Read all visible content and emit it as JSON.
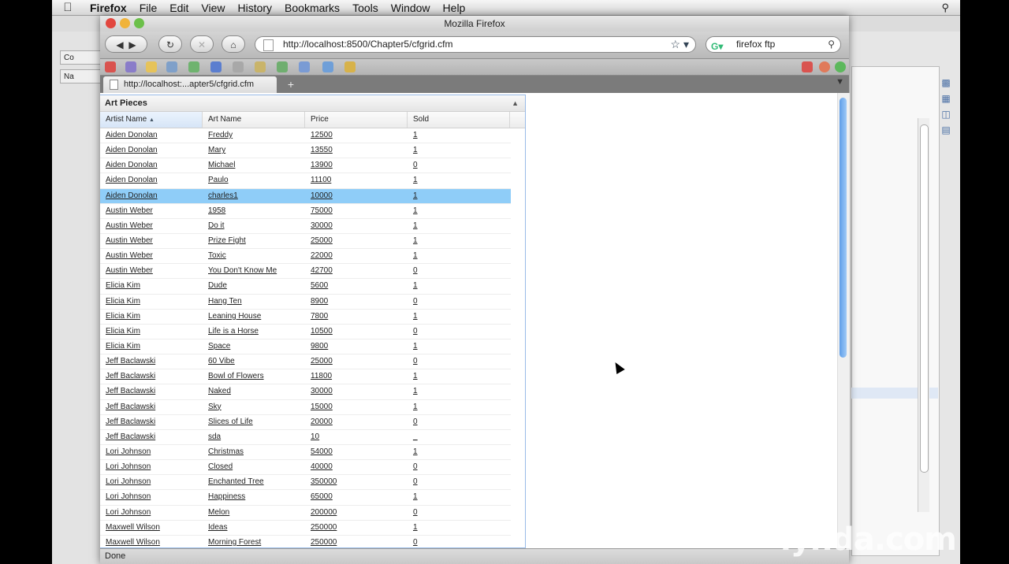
{
  "menubar": {
    "app": "Firefox",
    "items": [
      "File",
      "Edit",
      "View",
      "History",
      "Bookmarks",
      "Tools",
      "Window",
      "Help"
    ]
  },
  "window": {
    "title": "Mozilla Firefox"
  },
  "navbar": {
    "url": "http://localhost:8500/Chapter5/cfgrid.cfm",
    "search": "firefox ftp"
  },
  "tab": {
    "label": "http://localhost:...apter5/cfgrid.cfm",
    "new_tab": "+"
  },
  "background": {
    "tab1": "Co",
    "tab2": "Na"
  },
  "grid": {
    "title": "Art Pieces",
    "columns": [
      "Artist Name",
      "Art Name",
      "Price",
      "Sold"
    ],
    "selected_index": 4,
    "rows": [
      [
        "Aiden Donolan",
        "Freddy",
        "12500",
        "1"
      ],
      [
        "Aiden Donolan",
        "Mary",
        "13550",
        "1"
      ],
      [
        "Aiden Donolan",
        "Michael",
        "13900",
        "0"
      ],
      [
        "Aiden Donolan",
        "Paulo",
        "11100",
        "1"
      ],
      [
        "Aiden Donolan",
        "charles1",
        "10000",
        "1"
      ],
      [
        "Austin Weber",
        "1958",
        "75000",
        "1"
      ],
      [
        "Austin Weber",
        "Do it",
        "30000",
        "1"
      ],
      [
        "Austin Weber",
        "Prize Fight",
        "25000",
        "1"
      ],
      [
        "Austin Weber",
        "Toxic",
        "22000",
        "1"
      ],
      [
        "Austin Weber",
        "You Don't Know Me",
        "42700",
        "0"
      ],
      [
        "Elicia Kim",
        "Dude",
        "5600",
        "1"
      ],
      [
        "Elicia Kim",
        "Hang Ten",
        "8900",
        "0"
      ],
      [
        "Elicia Kim",
        "Leaning House",
        "7800",
        "1"
      ],
      [
        "Elicia Kim",
        "Life is a Horse",
        "10500",
        "0"
      ],
      [
        "Elicia Kim",
        "Space",
        "9800",
        "1"
      ],
      [
        "Jeff Baclawski",
        "60 Vibe",
        "25000",
        "0"
      ],
      [
        "Jeff Baclawski",
        "Bowl of Flowers",
        "11800",
        "1"
      ],
      [
        "Jeff Baclawski",
        "Naked",
        "30000",
        "1"
      ],
      [
        "Jeff Baclawski",
        "Sky",
        "15000",
        "1"
      ],
      [
        "Jeff Baclawski",
        "Slices of Life",
        "20000",
        "0"
      ],
      [
        "Jeff Baclawski",
        "sda",
        "10",
        "_"
      ],
      [
        "Lori Johnson",
        "Christmas",
        "54000",
        "1"
      ],
      [
        "Lori Johnson",
        "Closed",
        "40000",
        "0"
      ],
      [
        "Lori Johnson",
        "Enchanted Tree",
        "350000",
        "0"
      ],
      [
        "Lori Johnson",
        "Happiness",
        "65000",
        "1"
      ],
      [
        "Lori Johnson",
        "Melon",
        "200000",
        "0"
      ],
      [
        "Maxwell Wilson",
        "Ideas",
        "250000",
        "1"
      ],
      [
        "Maxwell Wilson",
        "Morning Forest",
        "250000",
        "0"
      ]
    ]
  },
  "status": "Done",
  "watermark": "lynda.com",
  "icons": [
    "apple-icon",
    "spotlight-icon",
    "back-icon",
    "forward-icon",
    "reload-icon",
    "stop-icon",
    "home-icon",
    "bookmark-star-icon",
    "search-icon",
    "sort-asc-icon",
    "mouse-cursor-icon"
  ]
}
